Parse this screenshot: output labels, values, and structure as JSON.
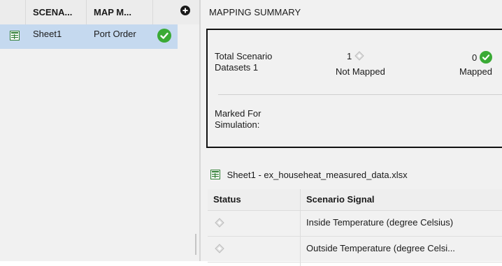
{
  "left_panel": {
    "columns": [
      "SCENA...",
      "MAP M..."
    ],
    "add_icon": "plus-circle-icon",
    "rows": [
      {
        "icon": "spreadsheet-icon",
        "scenario": "Sheet1",
        "map_mode": "Port Order",
        "status_icon": "check-circle-icon"
      }
    ]
  },
  "summary": {
    "title": "MAPPING SUMMARY",
    "total_label_line1": "Total Scenario",
    "total_label_line2": "Datasets 1",
    "not_mapped_count": "1",
    "not_mapped_label": "Not Mapped",
    "mapped_count": "0",
    "mapped_label": "Mapped",
    "marked_label_line1": "Marked For",
    "marked_label_line2": "Simulation:"
  },
  "file": {
    "icon": "spreadsheet-icon",
    "name": "Sheet1 - ex_househeat_measured_data.xlsx"
  },
  "signal_table": {
    "headers": [
      "Status",
      "Scenario Signal"
    ],
    "rows": [
      {
        "status_icon": "diamond-status-icon",
        "signal": "Inside Temperature (degree Celsius)"
      },
      {
        "status_icon": "diamond-status-icon",
        "signal": "Outside Temperature (degree Celsi..."
      }
    ]
  },
  "colors": {
    "selected_row": "#c5d9ef",
    "check_green": "#3aaa35",
    "panel_bg": "#f1f1f1"
  }
}
